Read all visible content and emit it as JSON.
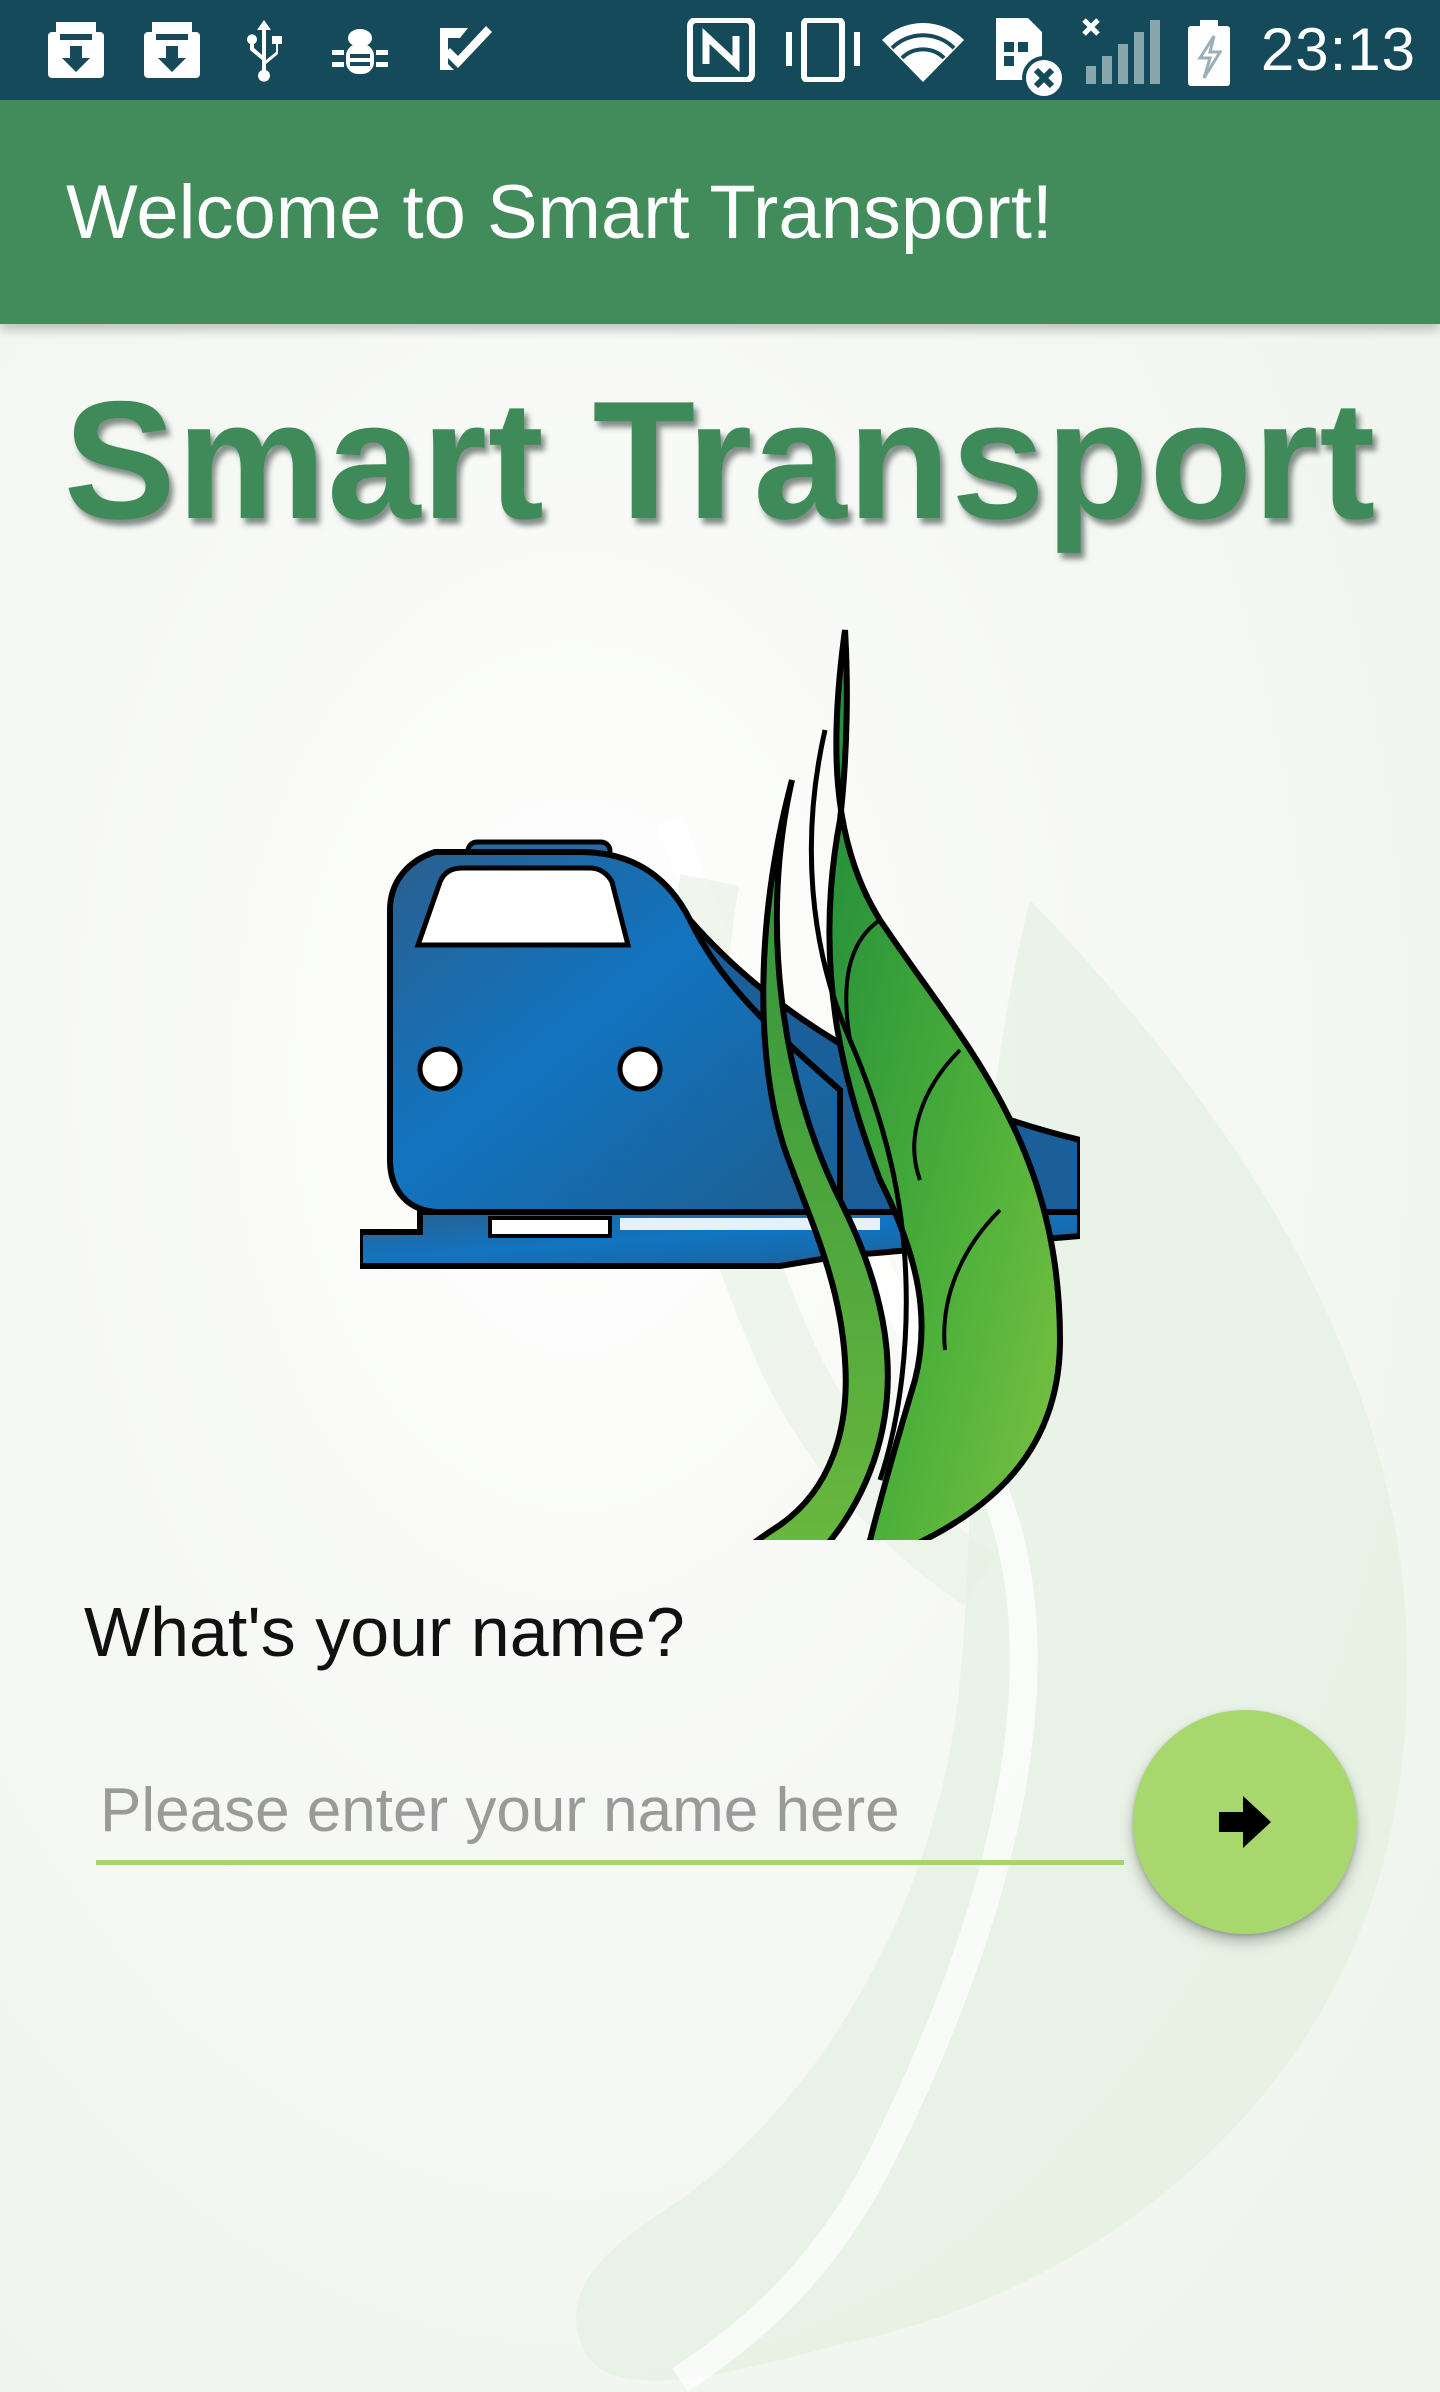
{
  "status_bar": {
    "time": "23:13",
    "icons": [
      "download-icon",
      "download-icon",
      "usb-icon",
      "bug-icon",
      "task-check-icon",
      "nfc-icon",
      "vibrate-icon",
      "wifi-icon",
      "sim-error-icon",
      "signal-no-service-icon",
      "battery-charging-icon"
    ],
    "background": "#154a5a"
  },
  "app_bar": {
    "title": "Welcome to Smart Transport!",
    "background": "#428c5c"
  },
  "hero": {
    "title": "Smart Transport",
    "color": "#3e8a59"
  },
  "logo": {
    "icons": [
      "train-icon",
      "leaf-icon"
    ],
    "train_color": "#1b6ca8",
    "leaf_color": "#4fae3a"
  },
  "form": {
    "prompt": "What's your name?",
    "name_input": {
      "value": "",
      "placeholder": "Please enter your name here"
    },
    "submit_icon": "arrow-right-icon",
    "accent": "#a8d76d"
  }
}
